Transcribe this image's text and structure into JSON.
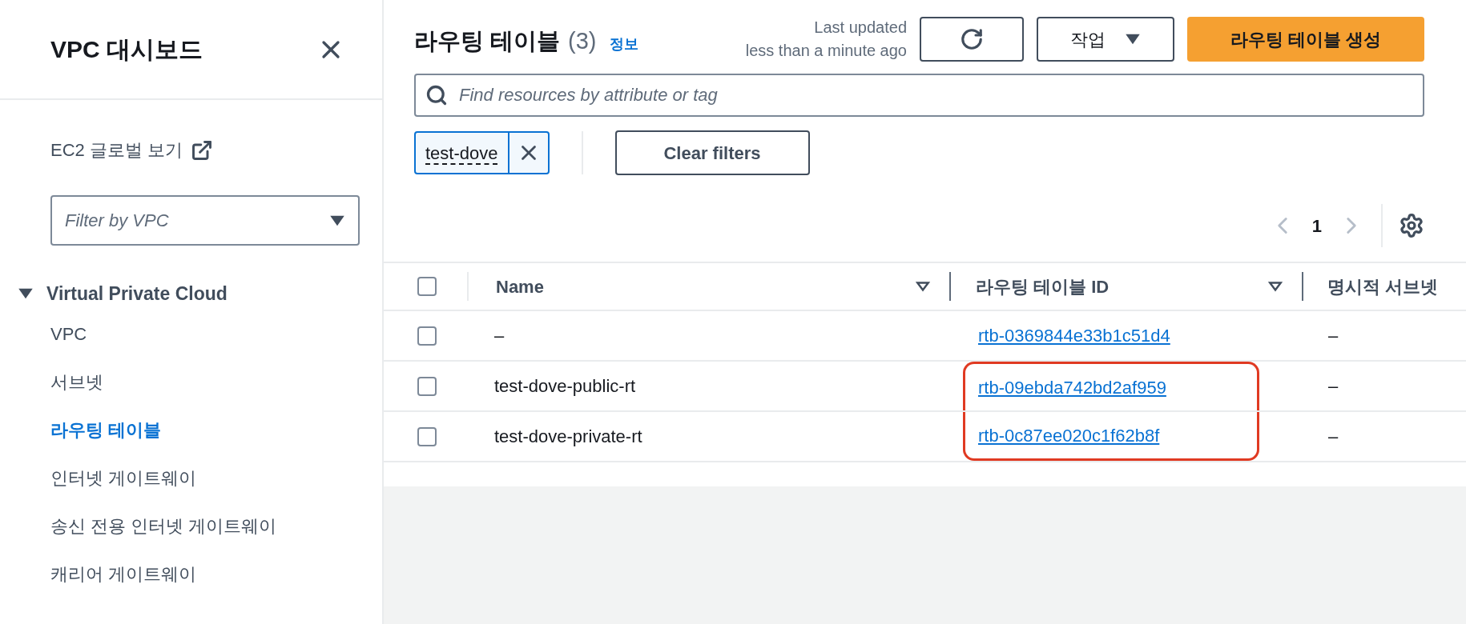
{
  "sidebar": {
    "title": "VPC 대시보드",
    "external_link": "EC2 글로벌 보기",
    "vpc_filter": {
      "placeholder": "Filter by VPC"
    },
    "section": {
      "label": "Virtual Private Cloud",
      "expanded": true,
      "items": [
        {
          "label": "VPC",
          "selected": false
        },
        {
          "label": "서브넷",
          "selected": false
        },
        {
          "label": "라우팅 테이블",
          "selected": true
        },
        {
          "label": "인터넷 게이트웨이",
          "selected": false
        },
        {
          "label": "송신 전용 인터넷 게이트웨이",
          "selected": false
        },
        {
          "label": "캐리어 게이트웨이",
          "selected": false
        }
      ]
    }
  },
  "header": {
    "title": "라우팅 테이블",
    "count": "(3)",
    "info_link": "정보",
    "last_updated": [
      "Last updated",
      "less than a minute ago"
    ],
    "actions_button": "작업",
    "create_button": "라우팅 테이블 생성"
  },
  "search": {
    "placeholder": "Find resources by attribute or tag"
  },
  "filter_tokens": [
    "test-dove"
  ],
  "clear_filters": "Clear filters",
  "pagination": {
    "page": "1",
    "prev_disabled": true,
    "next_disabled": true
  },
  "table": {
    "select_all": {
      "checked": false
    },
    "columns": [
      "Name",
      "라우팅 테이블 ID",
      "명시적 서브넷"
    ],
    "rows": [
      {
        "checked": false,
        "name": "–",
        "id": "rtb-0369844e33b1c51d4",
        "column_3": "–",
        "highlighted": false
      },
      {
        "checked": false,
        "name": "test-dove-public-rt",
        "id": "rtb-09ebda742bd2af959",
        "column_3": "–",
        "highlighted": true
      },
      {
        "checked": false,
        "name": "test-dove-private-rt",
        "id": "rtb-0c87ee020c1f62b8f",
        "column_3": "–",
        "highlighted": true
      }
    ]
  }
}
